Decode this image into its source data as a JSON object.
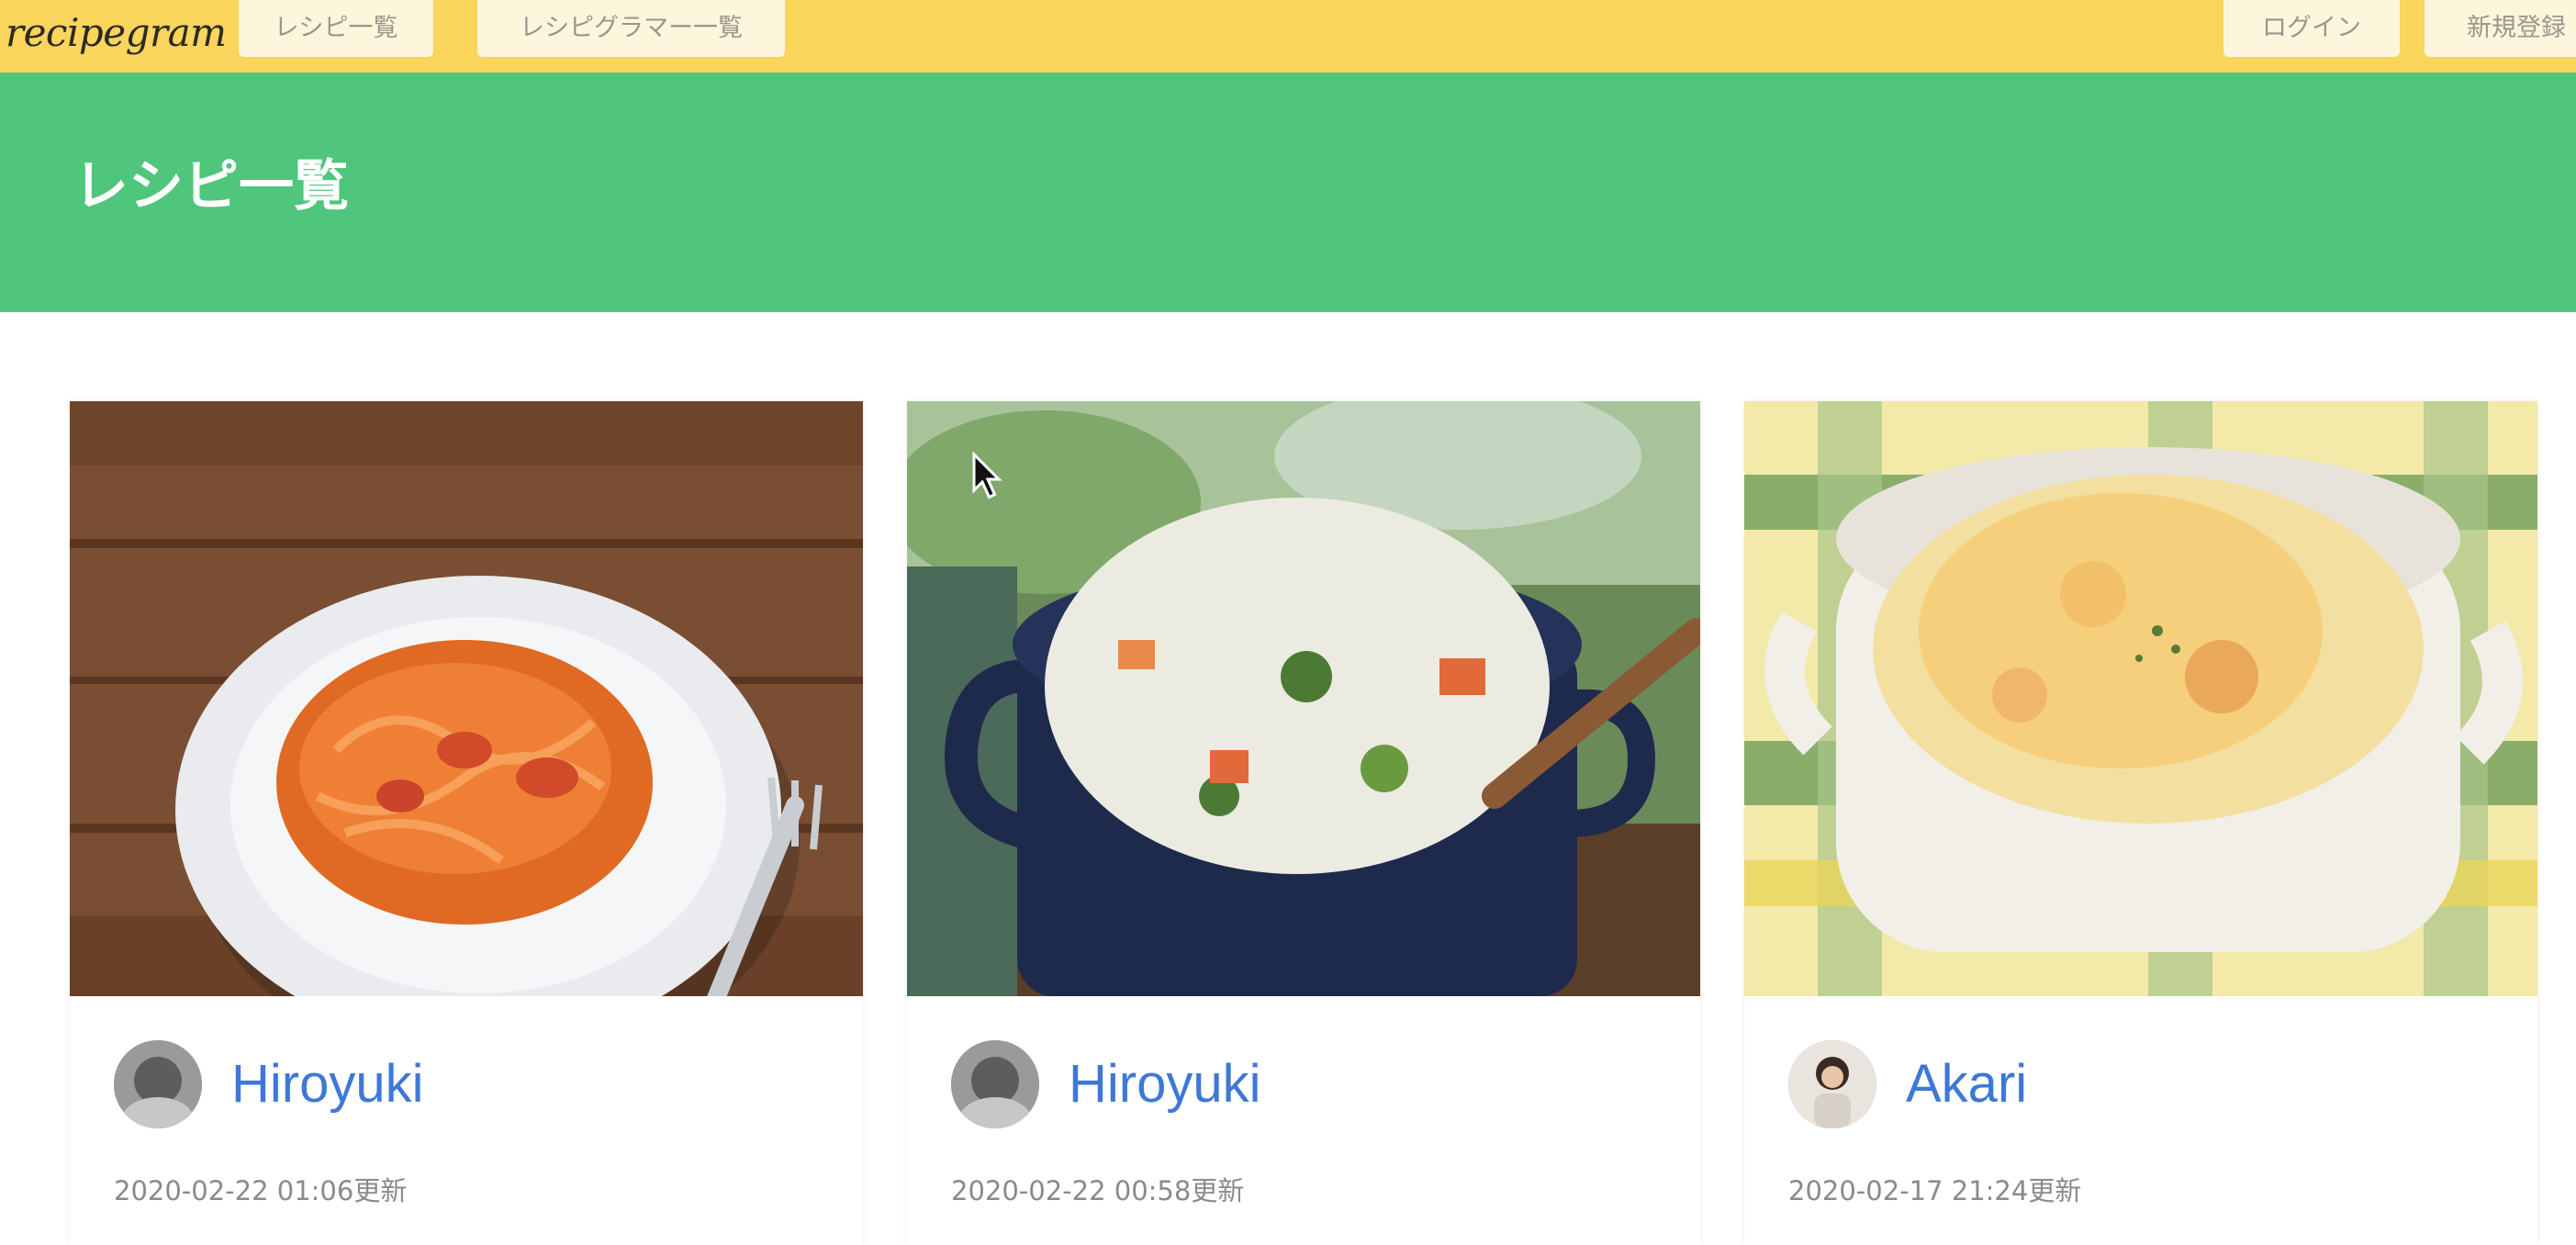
{
  "nav": {
    "brand": "recipegram",
    "links": [
      "レシピ一覧",
      "レシピグラマー一覧"
    ],
    "login": "ログイン",
    "signup": "新規登録"
  },
  "hero": {
    "title": "レシピ一覧"
  },
  "colors": {
    "navbar": "#f9d55c",
    "hero": "#4fc67b",
    "author_link": "#3e78d6"
  },
  "recipes": [
    {
      "author": "Hiroyuki",
      "updated": "2020-02-22 01:06更新",
      "photo": "napolitan-spaghetti-image"
    },
    {
      "author": "Hiroyuki",
      "updated": "2020-02-22 00:58更新",
      "photo": "cream-stew-pot-image"
    },
    {
      "author": "Akari",
      "updated": "2020-02-17 21:24更新",
      "photo": "gratin-dish-image"
    }
  ]
}
